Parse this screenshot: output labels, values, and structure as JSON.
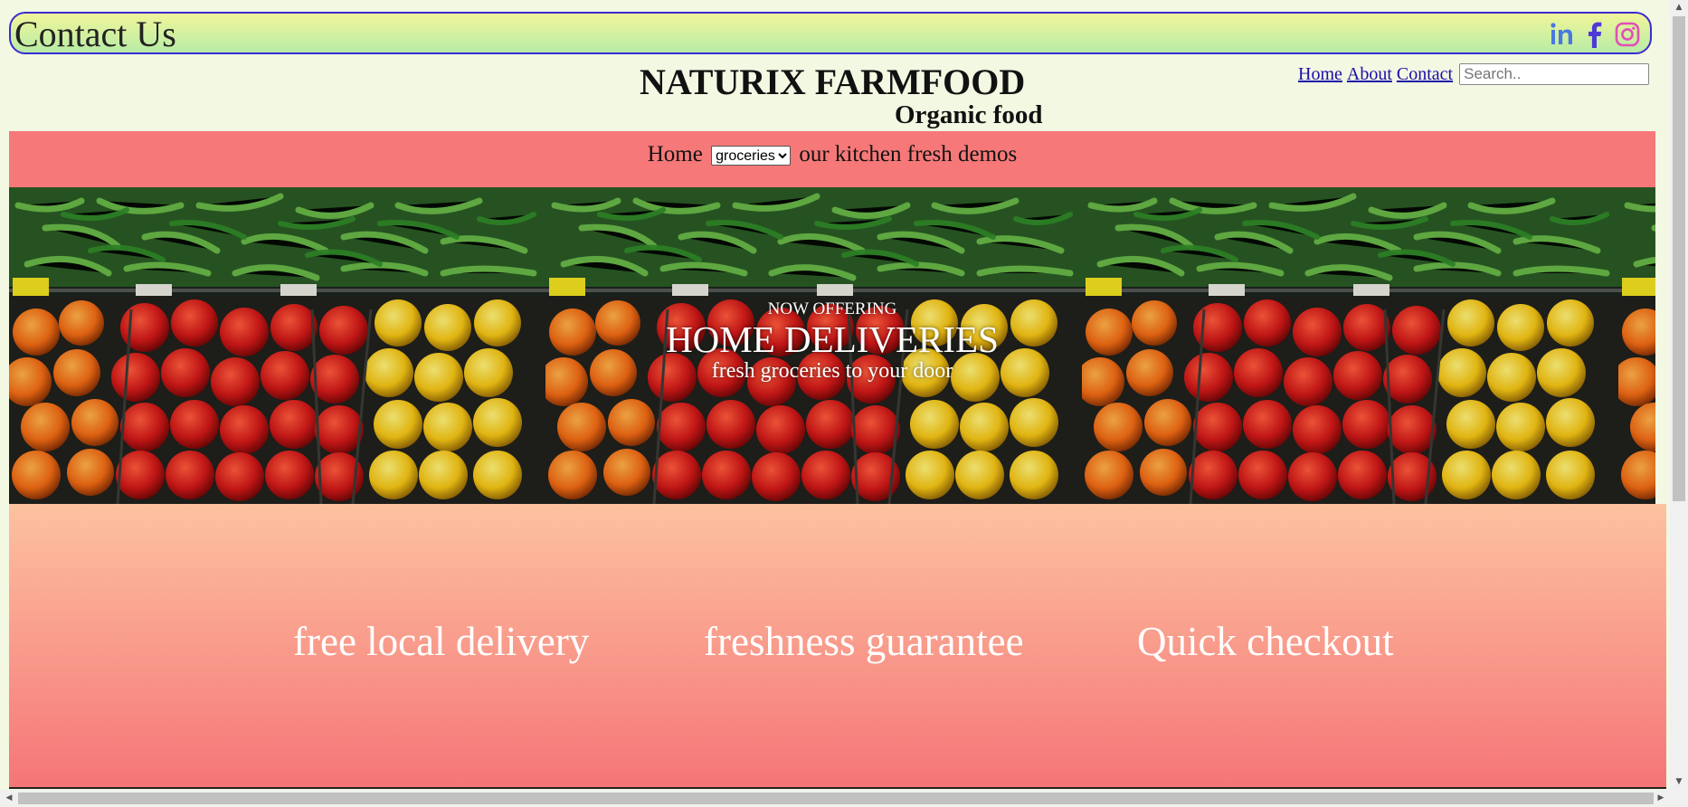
{
  "header": {
    "contact_title": "Contact Us",
    "social": [
      {
        "name": "linkedin-icon",
        "label": "in",
        "color": "#4a78e0"
      },
      {
        "name": "facebook-icon",
        "label": "f",
        "color": "#4d3ad8"
      },
      {
        "name": "instagram-icon",
        "label": "instagram",
        "color": "#e04fb6"
      }
    ]
  },
  "brand": {
    "name": "NATURIX FARMFOOD",
    "tagline": "Organic food"
  },
  "nav": {
    "home": "Home",
    "about": "About",
    "contact": "Contact",
    "search_placeholder": "Search.."
  },
  "menu": {
    "home": "Home",
    "select_value": "groceries",
    "rest": "our kitchen fresh demos"
  },
  "hero": {
    "eyebrow": "NOW OFFERING",
    "headline": "HOME DELIVERIES",
    "subline": "fresh groceries to your door"
  },
  "features": [
    "free local delivery",
    "freshness guarantee",
    "Quick checkout"
  ],
  "colors": {
    "menu_bg": "#f67878",
    "link": "#1a0dab",
    "features_top": "#fdc2a0",
    "features_bottom": "#f57577"
  }
}
